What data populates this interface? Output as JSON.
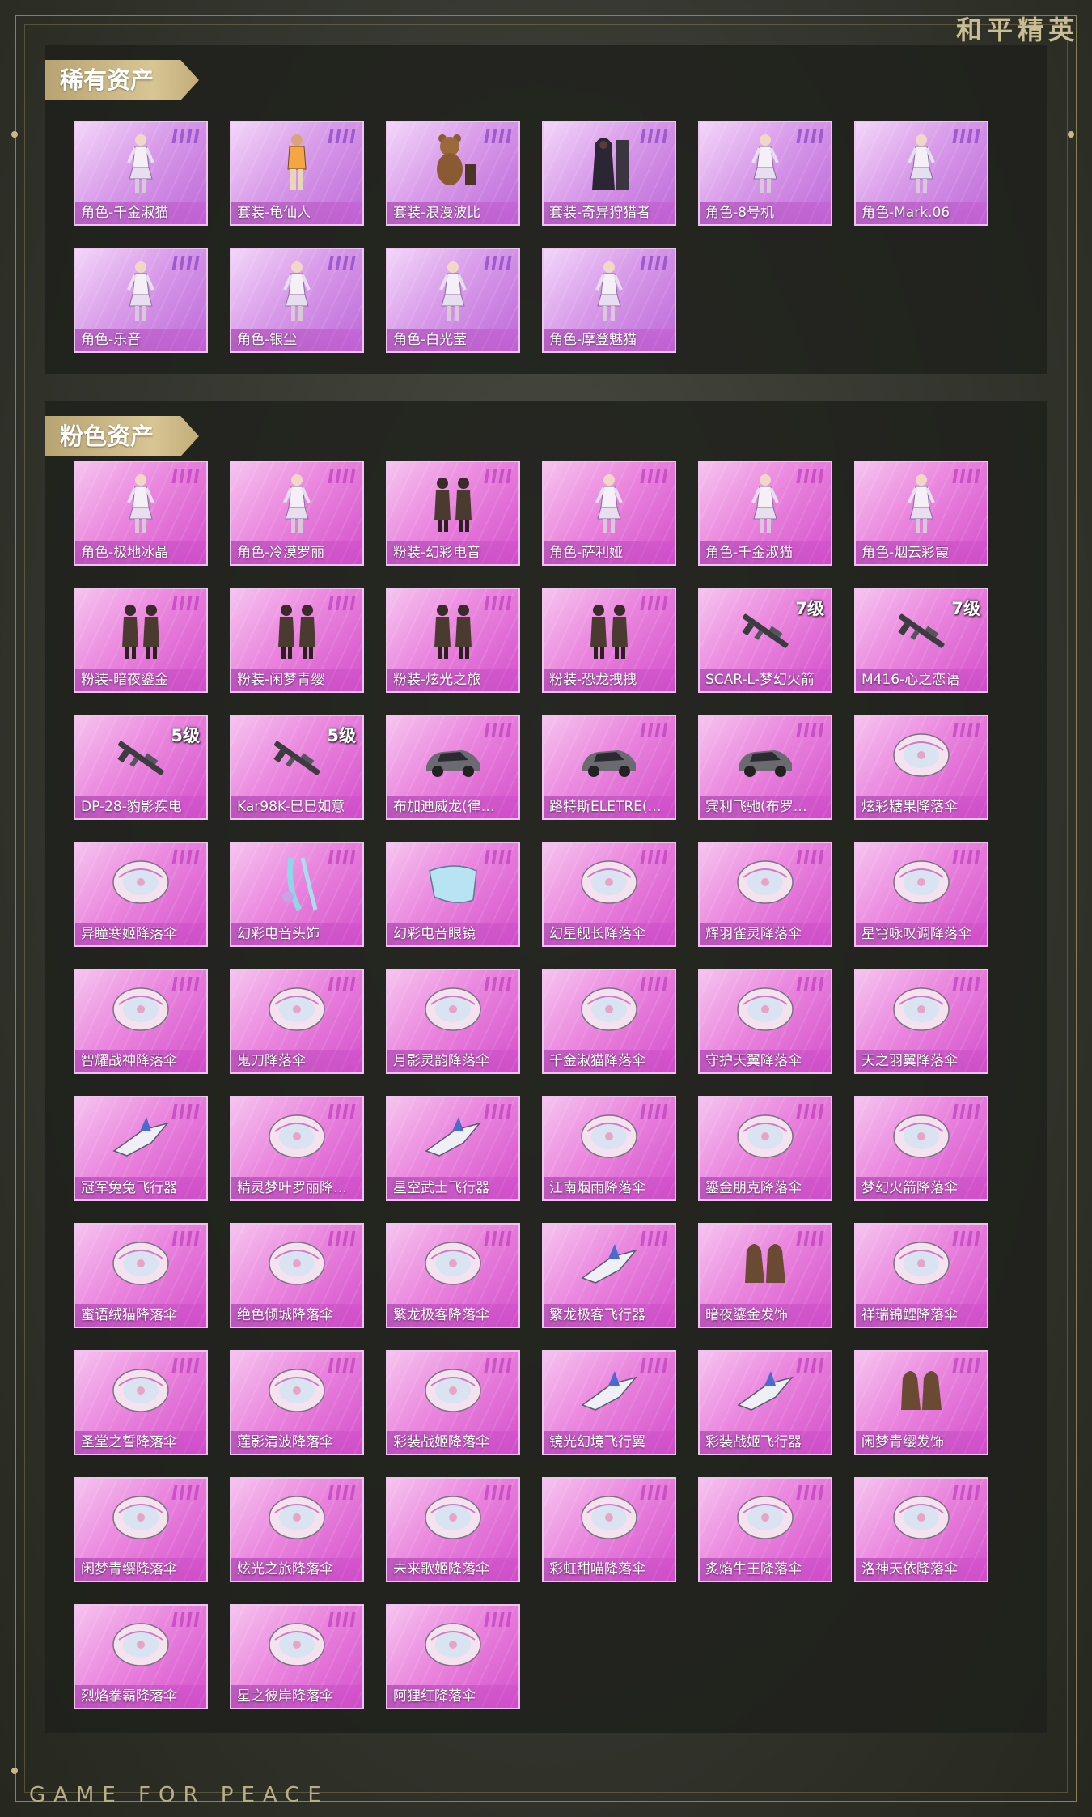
{
  "brand": {
    "title": "和平精英"
  },
  "footer": {
    "text": "GAME FOR PEACE"
  },
  "colors": {
    "gold": "#d8c594",
    "rare_card": "#d89be9",
    "pink_card": "#ea86de"
  },
  "sections": [
    {
      "title": "稀有资产",
      "items": [
        {
          "label": "角色-千金淑猫",
          "icon": "character-figure-icon"
        },
        {
          "label": "套装-龟仙人",
          "icon": "outfit-figure-icon"
        },
        {
          "label": "套装-浪漫波比",
          "icon": "bear-outfit-icon"
        },
        {
          "label": "套装-奇异狩猎者",
          "icon": "dark-outfit-icon"
        },
        {
          "label": "角色-8号机",
          "icon": "character-figure-icon"
        },
        {
          "label": "角色-Mark.06",
          "icon": "character-figure-icon"
        },
        {
          "label": "角色-乐音",
          "icon": "character-figure-icon"
        },
        {
          "label": "角色-银尘",
          "icon": "character-figure-icon"
        },
        {
          "label": "角色-白光莹",
          "icon": "character-figure-icon"
        },
        {
          "label": "角色-摩登魅猫",
          "icon": "character-figure-icon"
        }
      ]
    },
    {
      "title": "粉色资产",
      "items": [
        {
          "label": "角色-极地冰晶",
          "icon": "character-figure-icon"
        },
        {
          "label": "角色-冷漠罗丽",
          "icon": "character-figure-icon"
        },
        {
          "label": "粉装-幻彩电音",
          "icon": "outfit-pair-icon"
        },
        {
          "label": "角色-萨利娅",
          "icon": "character-figure-icon"
        },
        {
          "label": "角色-千金淑猫",
          "icon": "character-figure-icon"
        },
        {
          "label": "角色-烟云彩霞",
          "icon": "character-figure-icon"
        },
        {
          "label": "粉装-暗夜鎏金",
          "icon": "outfit-pair-icon"
        },
        {
          "label": "粉装-闲梦青缨",
          "icon": "outfit-pair-icon"
        },
        {
          "label": "粉装-炫光之旅",
          "icon": "outfit-pair-icon"
        },
        {
          "label": "粉装-恐龙拽拽",
          "icon": "outfit-pair-icon"
        },
        {
          "label": "SCAR-L-梦幻火箭",
          "icon": "rifle-icon",
          "level": "7级"
        },
        {
          "label": "M416-心之恋语",
          "icon": "rifle-icon",
          "level": "7级"
        },
        {
          "label": "DP-28-豹影疾电",
          "icon": "rifle-icon",
          "level": "5级"
        },
        {
          "label": "Kar98K-巳巳如意",
          "icon": "rifle-icon",
          "level": "5级"
        },
        {
          "label": "布加迪威龙(律…",
          "icon": "car-icon"
        },
        {
          "label": "路特斯ELETRE(…",
          "icon": "car-icon"
        },
        {
          "label": "宾利飞驰(布罗…",
          "icon": "car-icon"
        },
        {
          "label": "炫彩糖果降落伞",
          "icon": "parachute-icon"
        },
        {
          "label": "异瞳寒姬降落伞",
          "icon": "parachute-icon"
        },
        {
          "label": "幻彩电音头饰",
          "icon": "headwear-icon"
        },
        {
          "label": "幻彩电音眼镜",
          "icon": "glasses-icon"
        },
        {
          "label": "幻星舰长降落伞",
          "icon": "parachute-icon"
        },
        {
          "label": "辉羽雀灵降落伞",
          "icon": "parachute-icon"
        },
        {
          "label": "星穹咏叹调降落伞",
          "icon": "parachute-icon"
        },
        {
          "label": "智耀战神降落伞",
          "icon": "parachute-icon"
        },
        {
          "label": "鬼刀降落伞",
          "icon": "parachute-icon"
        },
        {
          "label": "月影灵韵降落伞",
          "icon": "parachute-icon"
        },
        {
          "label": "千金淑猫降落伞",
          "icon": "parachute-icon"
        },
        {
          "label": "守护天翼降落伞",
          "icon": "parachute-icon"
        },
        {
          "label": "天之羽翼降落伞",
          "icon": "parachute-icon"
        },
        {
          "label": "冠军兔兔飞行器",
          "icon": "glider-icon"
        },
        {
          "label": "精灵梦叶罗丽降…",
          "icon": "parachute-icon"
        },
        {
          "label": "星空武士飞行器",
          "icon": "glider-icon"
        },
        {
          "label": "江南烟雨降落伞",
          "icon": "parachute-icon"
        },
        {
          "label": "鎏金朋克降落伞",
          "icon": "parachute-icon"
        },
        {
          "label": "梦幻火箭降落伞",
          "icon": "parachute-icon"
        },
        {
          "label": "蜜语绒猫降落伞",
          "icon": "parachute-icon"
        },
        {
          "label": "绝色倾城降落伞",
          "icon": "parachute-icon"
        },
        {
          "label": "繁龙极客降落伞",
          "icon": "parachute-icon"
        },
        {
          "label": "繁龙极客飞行器",
          "icon": "glider-icon"
        },
        {
          "label": "暗夜鎏金发饰",
          "icon": "hair-accessory-icon"
        },
        {
          "label": "祥瑞锦鲤降落伞",
          "icon": "parachute-icon"
        },
        {
          "label": "圣堂之誓降落伞",
          "icon": "parachute-icon"
        },
        {
          "label": "莲影清波降落伞",
          "icon": "parachute-icon"
        },
        {
          "label": "彩装战姬降落伞",
          "icon": "parachute-icon"
        },
        {
          "label": "镜光幻境飞行翼",
          "icon": "glider-icon"
        },
        {
          "label": "彩装战姬飞行器",
          "icon": "glider-icon"
        },
        {
          "label": "闲梦青缨发饰",
          "icon": "hair-accessory-icon"
        },
        {
          "label": "闲梦青缨降落伞",
          "icon": "parachute-icon"
        },
        {
          "label": "炫光之旅降落伞",
          "icon": "parachute-icon"
        },
        {
          "label": "未来歌姬降落伞",
          "icon": "parachute-icon"
        },
        {
          "label": "彩虹甜喵降落伞",
          "icon": "parachute-icon"
        },
        {
          "label": "炙焰牛王降落伞",
          "icon": "parachute-icon"
        },
        {
          "label": "洛神天依降落伞",
          "icon": "parachute-icon"
        },
        {
          "label": "烈焰拳霸降落伞",
          "icon": "parachute-icon"
        },
        {
          "label": "星之彼岸降落伞",
          "icon": "parachute-icon"
        },
        {
          "label": "阿狸红降落伞",
          "icon": "parachute-icon"
        }
      ]
    }
  ]
}
